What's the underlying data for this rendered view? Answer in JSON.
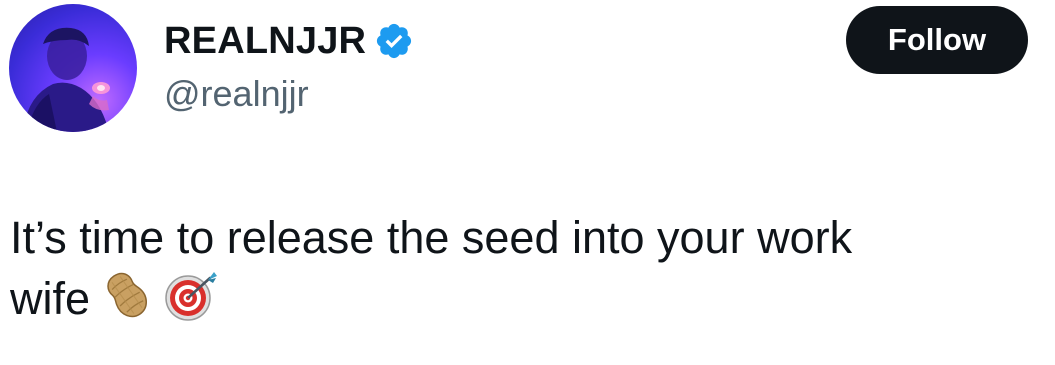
{
  "author": {
    "display_name": "REALNJJR",
    "handle": "@realnjjr",
    "verified": true,
    "verified_color": "#1d9bf0"
  },
  "actions": {
    "follow_label": "Follow"
  },
  "tweet": {
    "text_line1": "It’s time to release the seed into your work",
    "text_line2": "wife",
    "emojis": [
      "peanut-emoji",
      "bullseye-emoji"
    ]
  },
  "colors": {
    "text": "#0f1419",
    "secondary_text": "#536471",
    "button_bg": "#0f1419",
    "button_text": "#ffffff"
  }
}
